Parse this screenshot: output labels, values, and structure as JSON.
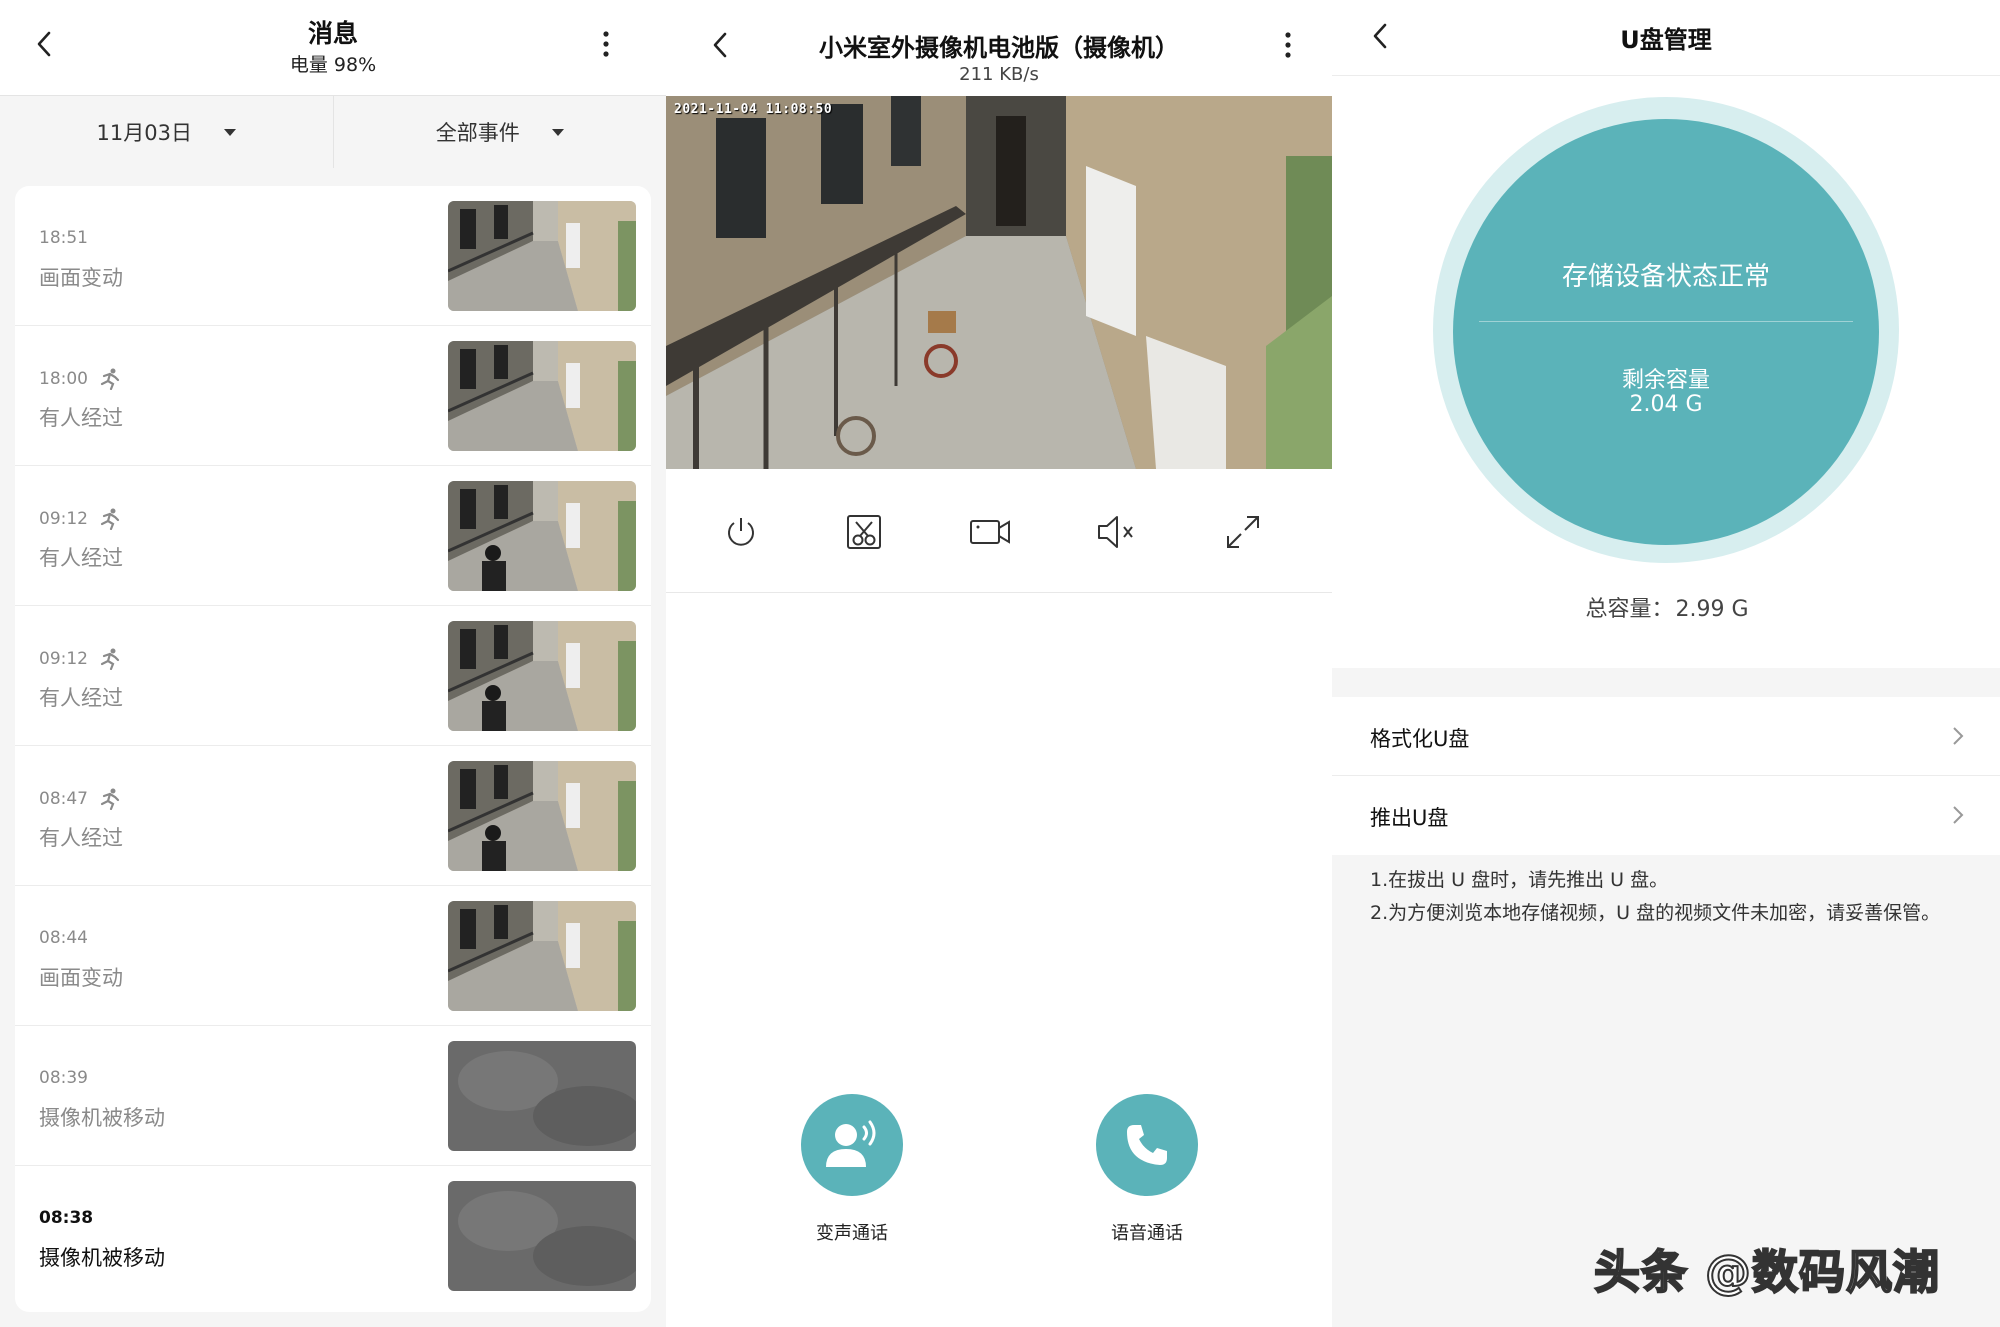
{
  "messages_panel": {
    "title": "消息",
    "battery": "电量 98%",
    "filters": {
      "date": "11月03日",
      "event_type": "全部事件"
    },
    "events": [
      {
        "time": "18:51",
        "label": "画面变动",
        "person": false,
        "scene": "balcony"
      },
      {
        "time": "18:00",
        "label": "有人经过",
        "person": true,
        "scene": "balcony"
      },
      {
        "time": "09:12",
        "label": "有人经过",
        "person": true,
        "scene": "people"
      },
      {
        "time": "09:12",
        "label": "有人经过",
        "person": true,
        "scene": "people"
      },
      {
        "time": "08:47",
        "label": "有人经过",
        "person": true,
        "scene": "people"
      },
      {
        "time": "08:44",
        "label": "画面变动",
        "person": false,
        "scene": "balcony"
      },
      {
        "time": "08:39",
        "label": "摄像机被移动",
        "person": false,
        "scene": "gray"
      },
      {
        "time": "08:38",
        "label": "摄像机被移动",
        "person": false,
        "scene": "gray"
      }
    ]
  },
  "camera_panel": {
    "title": "小米室外摄像机电池版（摄像机）",
    "bitrate": "211 KB/s",
    "timestamp": "2021-11-04 11:08:50",
    "controls": [
      "power-icon",
      "screenshot-icon",
      "record-icon",
      "mute-icon",
      "fullscreen-icon"
    ],
    "calls": {
      "voice_change": "变声通话",
      "voice": "语音通话"
    }
  },
  "storage_panel": {
    "title": "U盘管理",
    "status": "存储设备状态正常",
    "remaining_label": "剩余容量",
    "remaining_value": "2.04 G",
    "total_label": "总容量：",
    "total_value": "2.99 G",
    "menu": [
      "格式化U盘",
      "推出U盘"
    ],
    "notes": [
      "1.在拔出 U 盘时，请先推出 U 盘。",
      "2.为方便浏览本地存储视频，U 盘的视频文件未加密，请妥善保管。"
    ]
  },
  "watermark": "头条 @数码风潮",
  "colors": {
    "accent": "#5bb3b9",
    "ring": "#d7eeef"
  }
}
